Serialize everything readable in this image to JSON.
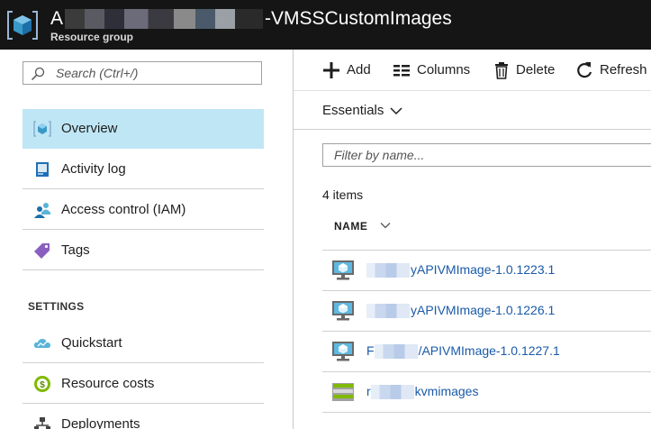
{
  "header": {
    "title_prefix": "A",
    "title_suffix": "-VMSSCustomImages",
    "subtitle": "Resource group"
  },
  "sidebar": {
    "search_placeholder": "Search (Ctrl+/)",
    "items": [
      {
        "label": "Overview",
        "icon": "cube-icon",
        "active": true
      },
      {
        "label": "Activity log",
        "icon": "activity-log-icon"
      },
      {
        "label": "Access control (IAM)",
        "icon": "users-icon"
      },
      {
        "label": "Tags",
        "icon": "tag-icon"
      }
    ],
    "settings_label": "SETTINGS",
    "settings_items": [
      {
        "label": "Quickstart",
        "icon": "cloud-icon"
      },
      {
        "label": "Resource costs",
        "icon": "cost-icon"
      },
      {
        "label": "Deployments",
        "icon": "deployments-icon"
      }
    ]
  },
  "toolbar": {
    "add_label": "Add",
    "columns_label": "Columns",
    "delete_label": "Delete",
    "refresh_label": "Refresh"
  },
  "essentials": {
    "label": "Essentials"
  },
  "filter": {
    "placeholder": "Filter by name..."
  },
  "list": {
    "count_text": "4 items",
    "column_name": "NAME",
    "rows": [
      {
        "prefix": "",
        "name": "yAPIVMImage-1.0.1223.1",
        "icon": "vm-image-icon"
      },
      {
        "prefix": "",
        "name": "yAPIVMImage-1.0.1226.1",
        "icon": "vm-image-icon"
      },
      {
        "prefix": "F",
        "name": "/APIVMImage-1.0.1227.1",
        "icon": "vm-image-icon"
      },
      {
        "prefix": "r",
        "name": "kvmimages",
        "icon": "storage-account-icon"
      }
    ]
  },
  "colors": {
    "header_bg": "#151515",
    "active_item_bg": "#bfe6f5",
    "link": "#1a5aa8",
    "accent": "#0078d7"
  }
}
